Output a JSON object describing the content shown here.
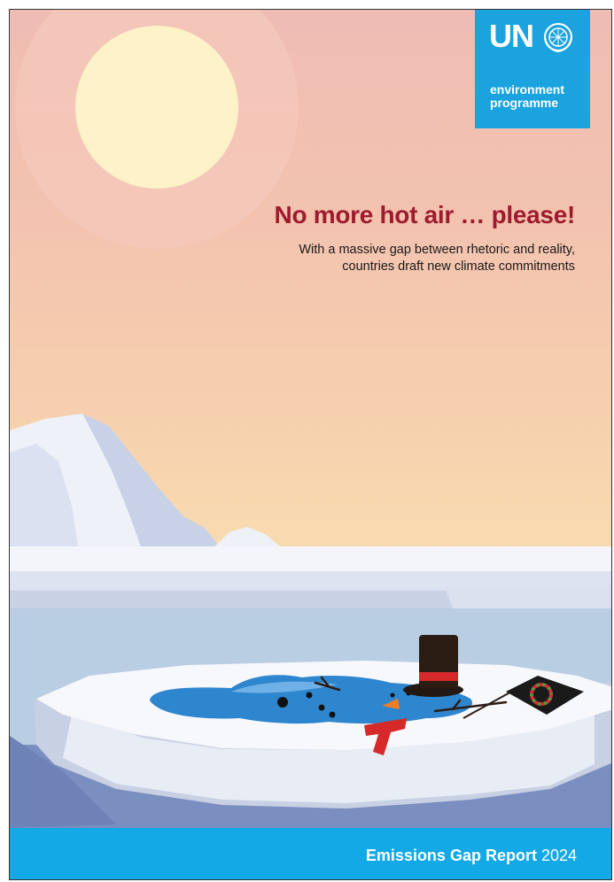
{
  "logo": {
    "mark": "UN",
    "emblem_icon": "un-emblem-icon",
    "line1": "environment",
    "line2": "programme"
  },
  "title": "No more hot air … please!",
  "subtitle": {
    "line1": "With a massive gap between rhetoric and reality,",
    "line2": "countries draft new climate commitments"
  },
  "footer": {
    "report_name": "Emissions Gap Report",
    "year": "2024"
  },
  "colors": {
    "title": "#9e1b2e",
    "un_blue": "#1aa3de",
    "footer_blue": "#12a9e6"
  }
}
